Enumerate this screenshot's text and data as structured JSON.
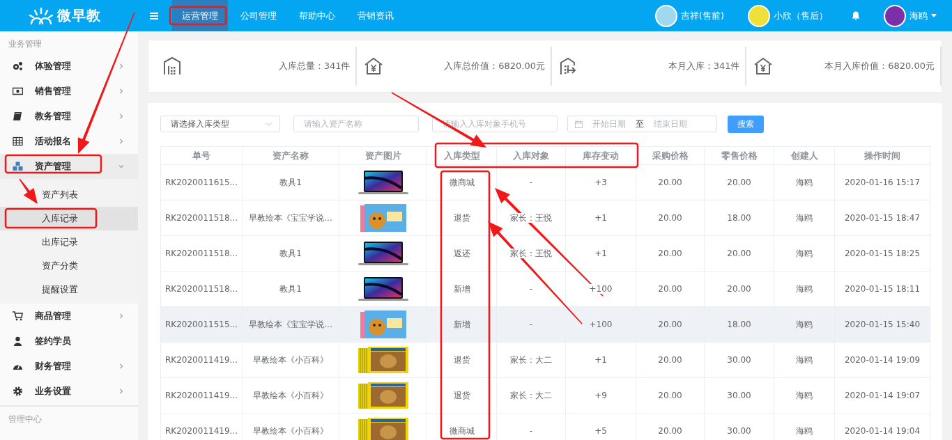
{
  "topbar": {
    "logo": "微早教",
    "nav": [
      {
        "label": "运营管理",
        "selected": true
      },
      {
        "label": "公司管理",
        "selected": false
      },
      {
        "label": "帮助中心",
        "selected": false
      },
      {
        "label": "营销资讯",
        "selected": false
      }
    ],
    "contacts": [
      {
        "name": "吉祥(售前)",
        "color": "#9fd8ef"
      },
      {
        "name": "小欣（售后）",
        "color": "#f2e03a"
      }
    ],
    "user": {
      "name": "海鸥"
    }
  },
  "sidebar": {
    "sections": [
      {
        "title": "业务管理",
        "items": [
          {
            "label": "体验管理",
            "expandable": true,
            "expanded": false
          },
          {
            "label": "销售管理",
            "expandable": true,
            "expanded": false
          },
          {
            "label": "教务管理",
            "expandable": true,
            "expanded": false
          },
          {
            "label": "活动报名",
            "expandable": true,
            "expanded": false
          },
          {
            "label": "资产管理",
            "expandable": true,
            "expanded": true,
            "children": [
              {
                "label": "资产列表",
                "selected": false
              },
              {
                "label": "入库记录",
                "selected": true
              },
              {
                "label": "出库记录",
                "selected": false
              },
              {
                "label": "资产分类",
                "selected": false
              },
              {
                "label": "提醒设置",
                "selected": false
              }
            ]
          },
          {
            "label": "商品管理",
            "expandable": true,
            "expanded": false
          },
          {
            "label": "签约学员",
            "expandable": false,
            "expanded": false
          },
          {
            "label": "财务管理",
            "expandable": true,
            "expanded": false
          },
          {
            "label": "业务设置",
            "expandable": true,
            "expanded": false
          }
        ]
      },
      {
        "title": "管理中心"
      }
    ]
  },
  "stats": [
    {
      "text": "入库总量：341件"
    },
    {
      "text": "入库总价值：6820.00元"
    },
    {
      "text": "本月入库：341件"
    },
    {
      "text": "本月入库价值：6820.00元"
    }
  ],
  "filters": {
    "type_select": {
      "placeholder": "请选择入库类型"
    },
    "asset_name": {
      "placeholder": "请输入资产名称"
    },
    "phone": {
      "placeholder": "请输入入库对象手机号"
    },
    "date_range": {
      "start_placeholder": "开始日期",
      "separator": "至",
      "end_placeholder": "结束日期"
    },
    "search_button": "搜索"
  },
  "table": {
    "columns": [
      "单号",
      "资产名称",
      "资产图片",
      "入库类型",
      "入库对象",
      "库存变动",
      "采购价格",
      "零售价格",
      "创建人",
      "操作时间"
    ],
    "rows": [
      {
        "no": "RK2020011615...",
        "name": "教具1",
        "kind": "laptop",
        "type": "微商城",
        "target": "-",
        "change": "+3",
        "purchase": "20.00",
        "retail": "20.00",
        "creator": "海鸥",
        "time": "2020-01-16 15:17",
        "hovered": false
      },
      {
        "no": "RK2020011518...",
        "name": "早教绘本《宝宝学说...",
        "kind": "bear-book",
        "type": "退货",
        "target": "家长：王悦",
        "change": "+1",
        "purchase": "20.00",
        "retail": "18.00",
        "creator": "海鸥",
        "time": "2020-01-15 18:47",
        "hovered": false
      },
      {
        "no": "RK2020011518...",
        "name": "教具1",
        "kind": "laptop",
        "type": "返还",
        "target": "家长：王悦",
        "change": "+1",
        "purchase": "20.00",
        "retail": "20.00",
        "creator": "海鸥",
        "time": "2020-01-15 18:25",
        "hovered": false
      },
      {
        "no": "RK2020011518...",
        "name": "教具1",
        "kind": "laptop",
        "type": "新增",
        "target": "-",
        "change": "+100",
        "purchase": "20.00",
        "retail": "20.00",
        "creator": "海鸥",
        "time": "2020-01-15 18:11",
        "hovered": false
      },
      {
        "no": "RK2020011515...",
        "name": "早教绘本《宝宝学说...",
        "kind": "bear-book",
        "type": "新增",
        "target": "-",
        "change": "+100",
        "purchase": "20.00",
        "retail": "18.00",
        "creator": "海鸥",
        "time": "2020-01-15 15:40",
        "hovered": true
      },
      {
        "no": "RK2020011419...",
        "name": "早教绘本《小百科》",
        "kind": "lion-book",
        "type": "退货",
        "target": "家长：大二",
        "change": "+1",
        "purchase": "20.00",
        "retail": "30.00",
        "creator": "海鸥",
        "time": "2020-01-14 19:09",
        "hovered": false
      },
      {
        "no": "RK2020011419...",
        "name": "早教绘本《小百科》",
        "kind": "lion-book",
        "type": "退货",
        "target": "家长：大二",
        "change": "+9",
        "purchase": "20.00",
        "retail": "30.00",
        "creator": "海鸥",
        "time": "2020-01-14 19:07",
        "hovered": false
      },
      {
        "no": "RK2020011419...",
        "name": "早教绘本《小百科》",
        "kind": "lion-book",
        "type": "微商城",
        "target": "-",
        "change": "+5",
        "purchase": "20.00",
        "retail": "30.00",
        "creator": "海鸥",
        "time": "2020-01-14 19:04",
        "hovered": false
      }
    ]
  }
}
